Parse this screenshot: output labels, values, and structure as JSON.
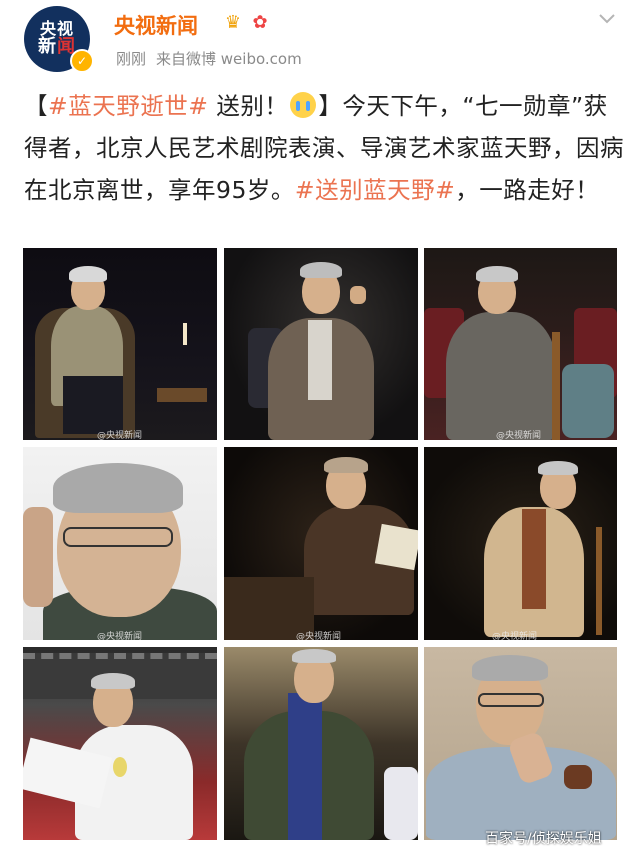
{
  "account": {
    "avatar_line1": "央视",
    "avatar_line2_a": "新",
    "avatar_line2_b": "闻",
    "name": "央视新闻",
    "time": "刚刚",
    "source": "来自微博 weibo.com"
  },
  "post": {
    "bracket_open": "【",
    "hashtag1": "#蓝天野逝世#",
    "farewell": " 送别！",
    "emoji": "crying-face",
    "bracket_close": "】",
    "body": "今天下午，“七一勋章”获得者，北京人民艺术剧院表演、导演艺术家蓝天野，因病在北京离世，享年95岁。",
    "hashtag2": "#送别蓝天野#",
    "closing": "，一路走好！"
  },
  "photos": [
    {
      "watermark": "@央视新闻"
    },
    {
      "watermark": ""
    },
    {
      "watermark": "@央视新闻"
    },
    {
      "watermark": "@央视新闻"
    },
    {
      "watermark": "@央视新闻"
    },
    {
      "watermark": "@央视新闻"
    },
    {
      "watermark": ""
    },
    {
      "watermark": ""
    },
    {
      "watermark": ""
    }
  ],
  "footer_watermark": "百家号/侦探娱乐姐",
  "colors": {
    "name": "#f26d10",
    "hashtag": "#eb7350",
    "meta": "#8a8a8a"
  }
}
